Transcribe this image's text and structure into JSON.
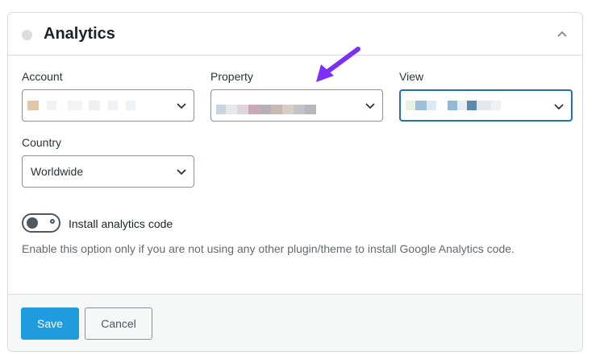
{
  "panel": {
    "title": "Analytics",
    "status": "inactive"
  },
  "fields": {
    "account": {
      "label": "Account",
      "value": ""
    },
    "property": {
      "label": "Property",
      "value": ""
    },
    "view": {
      "label": "View",
      "value": ""
    },
    "country": {
      "label": "Country",
      "value": "Worldwide"
    }
  },
  "toggle": {
    "label": "Install analytics code",
    "state": "off"
  },
  "help_text": "Enable this option only if you are not using any other plugin/theme to install Google Analytics code.",
  "buttons": {
    "save": "Save",
    "cancel": "Cancel"
  },
  "colors": {
    "primary": "#1f9be0",
    "focus": "#2271b1",
    "annotation_arrow": "#7b2ff7"
  },
  "icons": {
    "collapse": "chevron-up-icon",
    "select": "chevron-down-icon",
    "annotation": "arrow-icon"
  }
}
